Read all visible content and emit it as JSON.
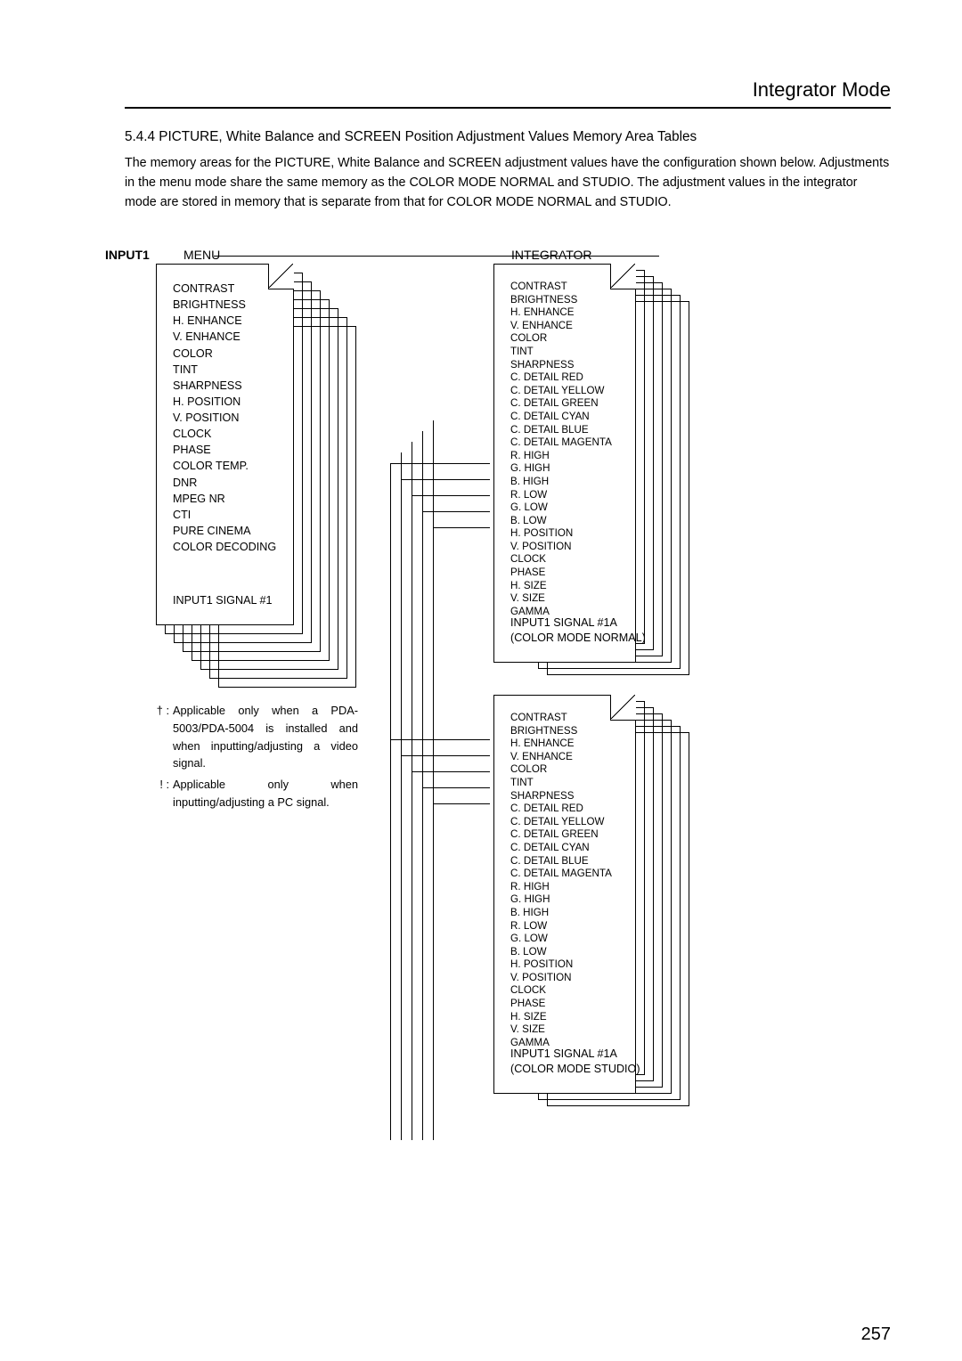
{
  "header_title": "Integrator Mode",
  "section_title": "5.4.4 PICTURE, White Balance and SCREEN Position Adjustment Values Memory Area Tables",
  "body_text": "The memory areas for the PICTURE, White Balance and SCREEN adjustment values have the configuration shown below. Adjustments in the menu mode share the same memory as the COLOR MODE NORMAL and STUDIO. The adjustment values in the integrator mode are stored in memory that is separate from that for COLOR MODE NORMAL and STUDIO.",
  "input_label": "INPUT1",
  "menu_heading": "MENU",
  "integrator_heading": "INTEGRATOR",
  "menu_card": {
    "lines": "CONTRAST\nBRIGHTNESS\nH. ENHANCE\nV. ENHANCE\nCOLOR\nTINT\nSHARPNESS\nH. POSITION\nV. POSITION\nCLOCK\nPHASE\nCOLOR TEMP.\nDNR\nMPEG NR\nCTI\nPURE CINEMA\nCOLOR DECODING",
    "footer": "INPUT1 SIGNAL #1"
  },
  "int_card_a": {
    "lines": "CONTRAST\nBRIGHTNESS\nH. ENHANCE\nV. ENHANCE\nCOLOR\nTINT\nSHARPNESS\nC. DETAIL RED\nC. DETAIL YELLOW\nC. DETAIL GREEN\nC. DETAIL CYAN\nC. DETAIL BLUE\nC. DETAIL MAGENTA\nR. HIGH\nG. HIGH\nB. HIGH\nR. LOW\nG. LOW\nB. LOW\nH. POSITION\nV. POSITION\nCLOCK\nPHASE\nH. SIZE\nV. SIZE\nGAMMA",
    "footer": "INPUT1 SIGNAL #1A\n(COLOR MODE NORMAL)"
  },
  "int_card_b": {
    "lines": "CONTRAST\nBRIGHTNESS\nH. ENHANCE\nV. ENHANCE\nCOLOR\nTINT\nSHARPNESS\nC. DETAIL RED\nC. DETAIL YELLOW\nC. DETAIL GREEN\nC. DETAIL CYAN\nC. DETAIL BLUE\nC. DETAIL MAGENTA\nR. HIGH\nG. HIGH\nB. HIGH\nR. LOW\nG. LOW\nB. LOW\nH. POSITION\nV. POSITION\nCLOCK\nPHASE\nH. SIZE\nV. SIZE\nGAMMA",
    "footer": "INPUT1 SIGNAL #1A\n(COLOR MODE STUDIO)"
  },
  "note_dagger_marker": "† :",
  "note_dagger_text": "Applicable only when a PDA-5003/PDA-5004 is installed and when inputting/adjusting a video signal.",
  "note_bang_marker": "! :",
  "note_bang_text": "Applicable only when inputting/adjusting a PC signal.",
  "page_number": "257"
}
